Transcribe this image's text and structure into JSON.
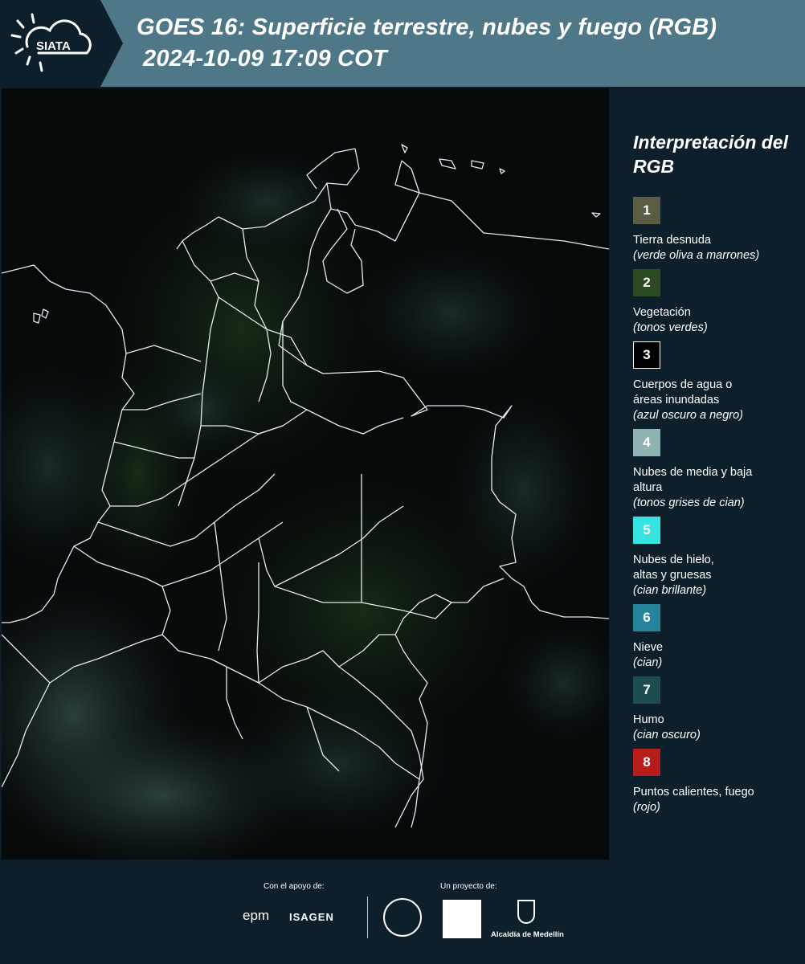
{
  "header": {
    "logo_text": "SIATA",
    "title_line1": "GOES 16: Superficie terrestre, nubes y fuego (RGB)",
    "title_line2": "2024-10-09 17:09 COT"
  },
  "legend": {
    "title": "Interpretación del RGB",
    "items": [
      {
        "number": "1",
        "label": "Tierra desnuda",
        "sub": "(verde oliva a marrones)",
        "color": "#5a5c43"
      },
      {
        "number": "2",
        "label": "Vegetación",
        "sub": "(tonos verdes)",
        "color": "#2c4a22"
      },
      {
        "number": "3",
        "label": "Cuerpos de agua o áreas inundadas",
        "sub": "(azul oscuro a negro)",
        "color": "#000000"
      },
      {
        "number": "4",
        "label": "Nubes de media y baja altura",
        "sub": "(tonos grises de cian)",
        "color": "#8fb3b2"
      },
      {
        "number": "5",
        "label": "Nubes de hielo, altas y gruesas",
        "sub": "(cian brillante)",
        "color": "#35e3e0"
      },
      {
        "number": "6",
        "label": "Nieve",
        "sub": "(cian)",
        "color": "#23849c"
      },
      {
        "number": "7",
        "label": "Humo",
        "sub": "(cian oscuro)",
        "color": "#1d4d50"
      },
      {
        "number": "8",
        "label": "Puntos calientes, fuego",
        "sub": "(rojo)",
        "color": "#b71c1c"
      }
    ]
  },
  "footer": {
    "support_label": "Con el apoyo de:",
    "project_label": "Un proyecto de:",
    "epm": "epm",
    "isagen": "ISAGEN",
    "alcaldia": "Alcaldía de Medellín"
  }
}
